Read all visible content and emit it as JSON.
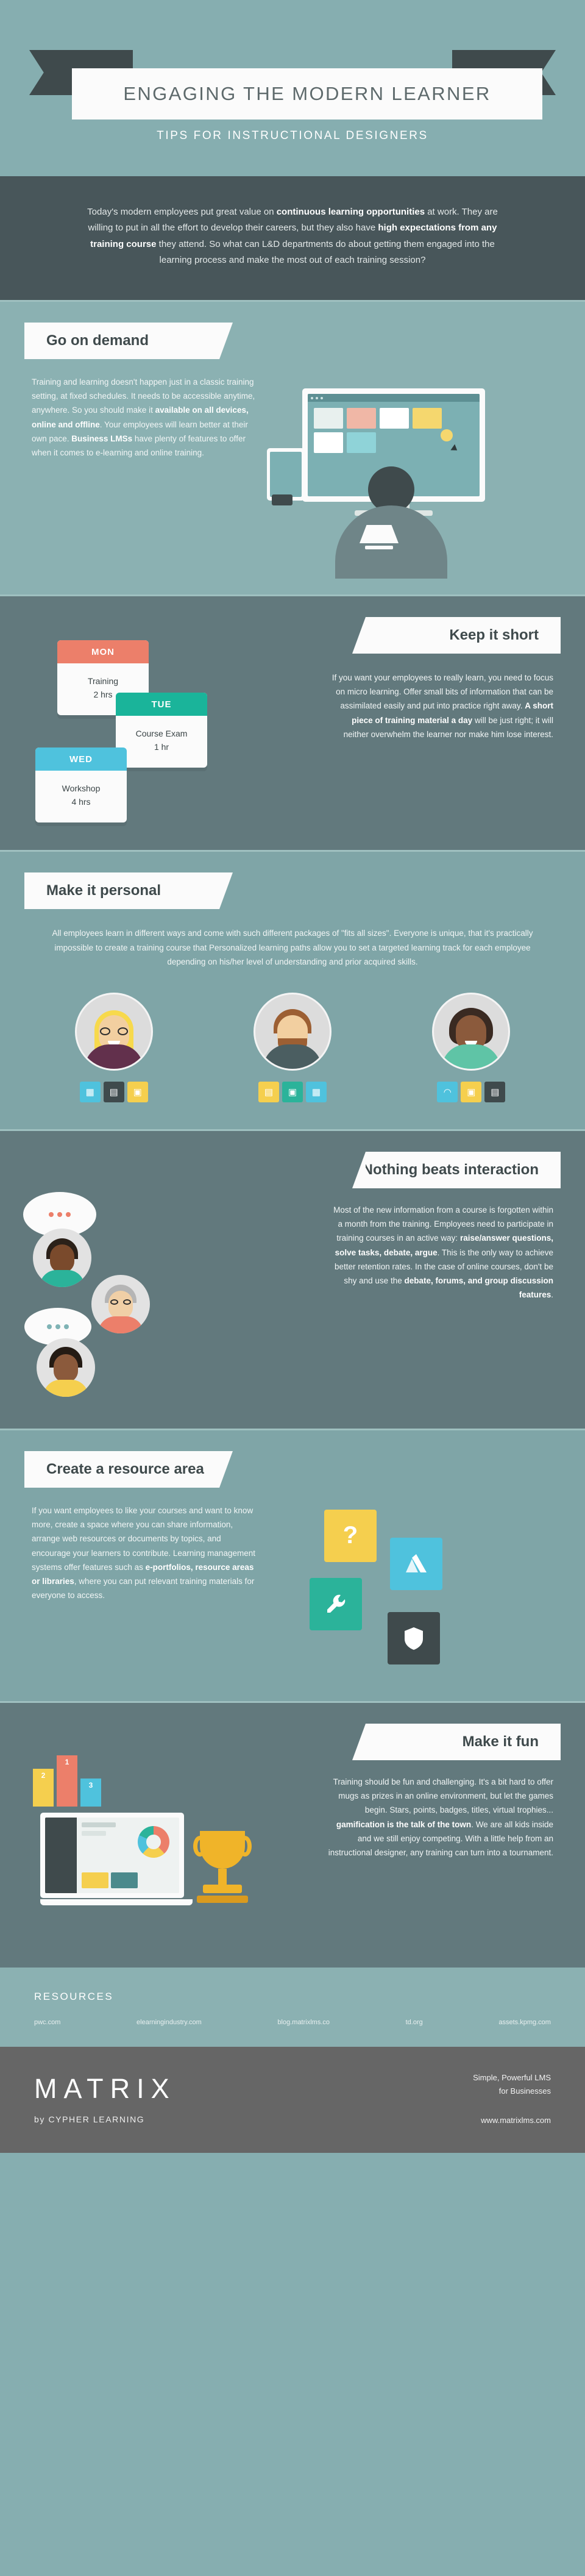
{
  "header": {
    "title": "ENGAGING THE MODERN LEARNER",
    "subtitle": "TIPS FOR INSTRUCTIONAL DESIGNERS"
  },
  "intro": {
    "part1": "Today's modern employees put great value on ",
    "bold1": "continuous learning opportunities",
    "part2": " at work. They are willing to put in all the effort to develop their careers, but they also have ",
    "bold2": "high expectations from any training course",
    "part3": " they attend. So what can L&D departments do about getting them engaged into the learning process and make the most out of each training session?"
  },
  "sections": [
    {
      "id": "go-on-demand",
      "heading": "Go on demand",
      "body_part1": "Training and learning doesn't happen just in a classic training setting, at fixed schedules. It needs to be accessible anytime, anywhere. So you should make it ",
      "body_bold1": "available on all devices, online and offline",
      "body_part2": ". Your employees will learn better at their own pace. ",
      "body_bold2": "Business LMSs",
      "body_part3": " have plenty of features to offer when it comes to e-learning and online training."
    },
    {
      "id": "keep-it-short",
      "heading": "Keep it short",
      "body_part1": "If you want your employees to really learn, you need to focus on micro learning. Offer small bits of information that can be assimilated easily and put into practice right away. ",
      "body_bold1": "A short piece of training material a day",
      "body_part2": " will be just right; it will neither overwhelm the learner nor make him lose interest."
    },
    {
      "id": "make-it-personal",
      "heading": "Make it personal",
      "body_part1": "All employees learn in different ways and come with such different packages of \"fits all sizes\". Everyone is unique, that it's practically impossible to create a training course that ",
      "body_bold1": "Personalized learning paths",
      "body_part2": " allow you to set a targeted learning track for each employee depending on his/her level of understanding and prior acquired skills."
    },
    {
      "id": "nothing-beats-interaction",
      "heading": "Nothing beats interaction",
      "body_part1": "Most of the new information from a course is forgotten within a month from the training. Employees need to participate in training courses in an active way: ",
      "body_bold1": "raise/answer questions, solve tasks, debate, argue",
      "body_part2": ". This is the only way to achieve better retention rates. In the case of online courses, don't be shy and use the ",
      "body_bold2": "debate, forums, and group discussion features",
      "body_part3": "."
    },
    {
      "id": "create-a-resource-area",
      "heading": "Create a resource area",
      "body_part1": "If you want employees to like your courses and want to know more, create a space where you can share information, arrange web resources or documents by topics, and encourage your learners to contribute. Learning management systems offer features such as ",
      "body_bold1": "e-portfolios, resource areas or libraries",
      "body_part2": ", where you can put relevant training materials for everyone to access."
    },
    {
      "id": "make-it-fun",
      "heading": "Make it fun",
      "body_part1": "Training should be fun and challenging. It's a bit hard to offer mugs as prizes in an online environment, but let the games begin. Stars, points, badges, titles, virtual trophies... ",
      "body_bold1": "gamification is the talk of the town",
      "body_part2": ". We are all kids inside and we still enjoy competing. With a little help from an instructional designer, any training can turn into a tournament."
    }
  ],
  "day_cards": [
    {
      "day": "MON",
      "activity": "Training",
      "duration": "2 hrs",
      "color": "#ec7f6a"
    },
    {
      "day": "TUE",
      "activity": "Course Exam",
      "duration": "1 hr",
      "color": "#1ab49a"
    },
    {
      "day": "WED",
      "activity": "Workshop",
      "duration": "4 hrs",
      "color": "#4fc2dd"
    }
  ],
  "avatars": [
    {
      "name": "avatar-woman-blonde",
      "hair": "#f7d94c",
      "shirt": "#62304c",
      "skin": "#f2cfa0",
      "icons": [
        "chart-icon",
        "book-icon",
        "chat-icon"
      ]
    },
    {
      "name": "avatar-man-beard",
      "hair": "#9c5f33",
      "shirt": "#4b5e61",
      "skin": "#e8b98a",
      "icons": [
        "document-icon",
        "chat-icon",
        "chart-icon"
      ]
    },
    {
      "name": "avatar-woman-dark",
      "hair": "#3a2a22",
      "shirt": "#5fc4a6",
      "skin": "#8b5a3c",
      "icons": [
        "headphones-icon",
        "chat-icon",
        "book-icon"
      ]
    }
  ],
  "resource_tiles": [
    {
      "name": "question-tile",
      "icon": "question-mark-icon",
      "color": "#f5cf4e"
    },
    {
      "name": "drive-tile",
      "icon": "triangle-drive-icon",
      "color": "#4fc2dd"
    },
    {
      "name": "wrench-tile",
      "icon": "wrench-icon",
      "color": "#2bb39a"
    },
    {
      "name": "shield-tile",
      "icon": "shield-icon",
      "color": "#3f4a4c"
    }
  ],
  "podium": {
    "first": "1",
    "second": "2",
    "third": "3"
  },
  "resources": {
    "title": "RESOURCES",
    "links": [
      "pwc.com",
      "elearningindustry.com",
      "blog.matrixlms.co",
      "td.org",
      "assets.kpmg.com"
    ]
  },
  "brand": {
    "name": "MATRIX",
    "byline": "by CYPHER LEARNING",
    "tagline_line1": "Simple, Powerful LMS",
    "tagline_line2": "for Businesses",
    "website": "www.matrixlms.com"
  },
  "colors": {
    "teal": "#8bb1b2",
    "dark_teal": "#62797d",
    "charcoal": "#48565a",
    "yellow": "#f7e03d",
    "coral": "#ec7f6a",
    "green": "#1ab49a",
    "blue": "#4fc2dd",
    "footer_gray": "#666666"
  }
}
